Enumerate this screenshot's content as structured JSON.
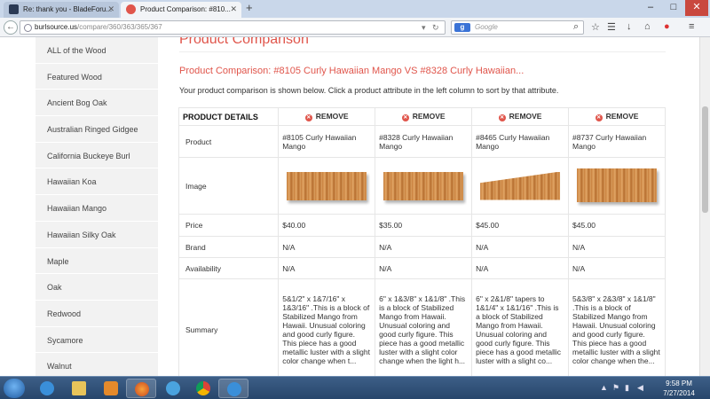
{
  "browser": {
    "tabs": [
      {
        "title": "Re: thank you - BladeForu...",
        "active": false
      },
      {
        "title": "Product Comparison: #810...",
        "active": true
      }
    ],
    "new_tab_icon": "plus-icon",
    "url_host": "burlsource.us",
    "url_path": "/compare/360/363/365/367",
    "search_placeholder": "Google",
    "search_engine_icon": "google-icon"
  },
  "sidebar": {
    "items": [
      {
        "label": "ALL of the Wood"
      },
      {
        "label": "Featured Wood"
      },
      {
        "label": "Ancient Bog Oak"
      },
      {
        "label": "Australian Ringed Gidgee"
      },
      {
        "label": "California Buckeye Burl"
      },
      {
        "label": "Hawaiian Koa"
      },
      {
        "label": "Hawaiian Mango"
      },
      {
        "label": "Hawaiian Silky Oak"
      },
      {
        "label": "Maple"
      },
      {
        "label": "Oak"
      },
      {
        "label": "Redwood"
      },
      {
        "label": "Sycamore"
      },
      {
        "label": "Walnut"
      }
    ]
  },
  "page": {
    "heading": "Product Comparison",
    "compare_title": "Product Comparison: #8105 Curly Hawaiian Mango VS #8328 Curly Hawaiian...",
    "intro": "Your product comparison is shown below. Click a product attribute in the left column to sort by that attribute.",
    "accent_color": "#e0554b"
  },
  "comparison": {
    "details_header": "PRODUCT DETAILS",
    "remove_label": "REMOVE",
    "row_labels": {
      "product": "Product",
      "image": "Image",
      "price": "Price",
      "brand": "Brand",
      "availability": "Availability",
      "summary": "Summary"
    },
    "products": [
      {
        "name": "#8105 Curly Hawaiian Mango",
        "price": "$40.00",
        "brand": "N/A",
        "availability": "N/A",
        "summary": "5&1/2\" x 1&7/16\" x 1&3/16\" .This is a block of Stabilized Mango from Hawaii. Unusual coloring and good curly figure. This piece has a good metallic luster with a slight color change when t..."
      },
      {
        "name": "#8328 Curly Hawaiian Mango",
        "price": "$35.00",
        "brand": "N/A",
        "availability": "N/A",
        "summary": "6\" x 1&3/8\" x 1&1/8\" .This is a block of Stabilized Mango from Hawaii. Unusual coloring and good curly figure. This piece has a good metallic luster with a slight color change when the light h..."
      },
      {
        "name": "#8465 Curly Hawaiian Mango",
        "price": "$45.00",
        "brand": "N/A",
        "availability": "N/A",
        "summary": "6\" x 2&1/8\" tapers to 1&1/4\" x 1&1/16\" .This is a block of Stabilized Mango from Hawaii. Unusual coloring and good curly figure. This piece has a good metallic luster with a slight co..."
      },
      {
        "name": "#8737 Curly Hawaiian Mango",
        "price": "$45.00",
        "brand": "N/A",
        "availability": "N/A",
        "summary": "5&3/8\" x 2&3/8\" x 1&1/8\" .This is a block of Stabilized Mango from Hawaii. Unusual coloring and good curly figure. This piece has a good metallic luster with a slight color change when the..."
      }
    ]
  },
  "taskbar": {
    "time": "9:58 PM",
    "date": "7/27/2014"
  }
}
